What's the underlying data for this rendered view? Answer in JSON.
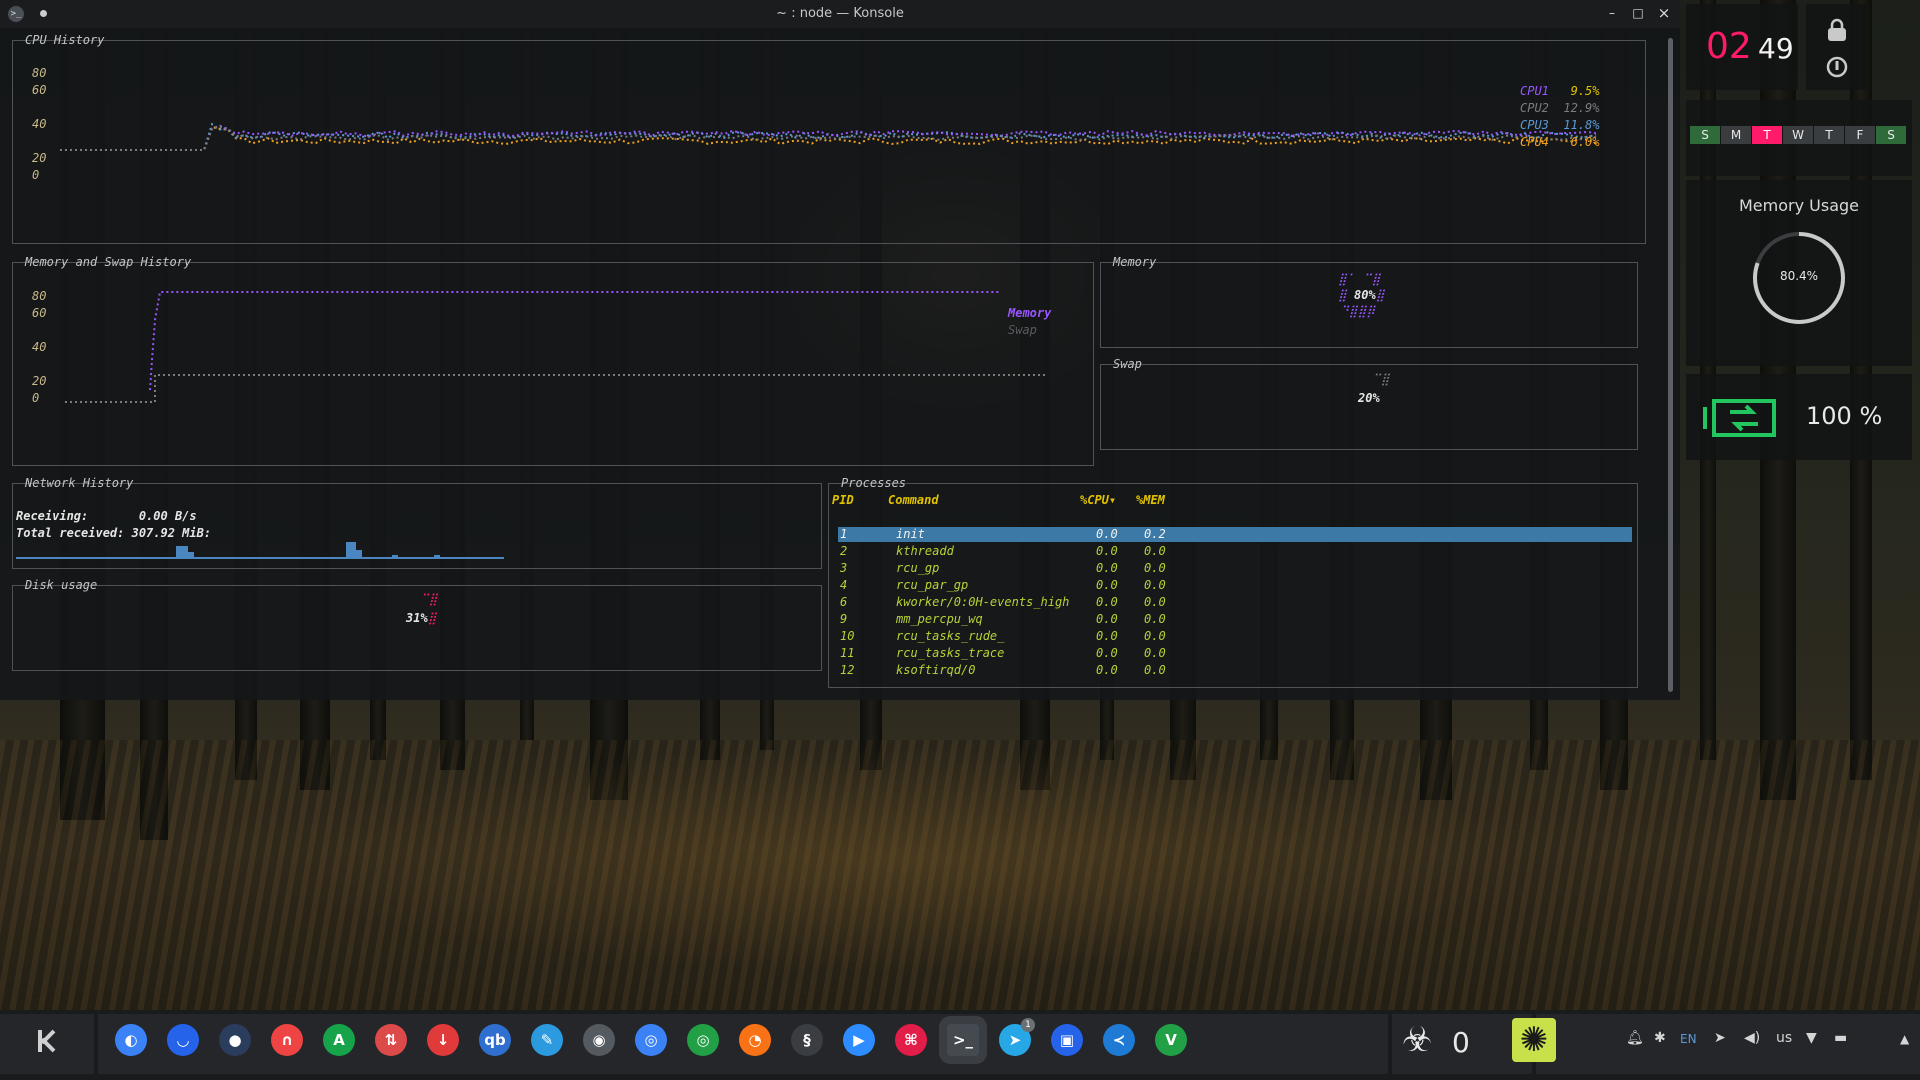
{
  "window": {
    "title": "~ : node — Konsole",
    "icon": "terminal-icon",
    "minimize": "–",
    "maximize": "□",
    "close": "×"
  },
  "cpu": {
    "title": "CPU History",
    "yticks": [
      "80",
      "60",
      "40",
      "20",
      "0"
    ],
    "legend": [
      {
        "name": "CPU1",
        "value": "9.5%",
        "color": "#9a55ff"
      },
      {
        "name": "CPU2",
        "value": "12.9%",
        "color": "#7a7d80"
      },
      {
        "name": "CPU3",
        "value": "11.8%",
        "color": "#5b9ad5"
      },
      {
        "name": "CPU4",
        "value": "6.0%",
        "color": "#f0a020"
      }
    ]
  },
  "memswap": {
    "title": "Memory and Swap History",
    "yticks": [
      "80",
      "60",
      "40",
      "20",
      "0"
    ],
    "legend_memory": "Memory",
    "legend_swap": "Swap",
    "memory_color": "#9a55ff",
    "swap_color": "#7a7d80"
  },
  "memory": {
    "title": "Memory",
    "value": "80%"
  },
  "swap": {
    "title": "Swap",
    "value": "20%"
  },
  "network": {
    "title": "Network History",
    "receiving_label": "Receiving:",
    "receiving_value": "0.00 B/s",
    "total_label": "Total received:",
    "total_value": "307.92 MiB:"
  },
  "disk": {
    "title": "Disk usage",
    "value": "31%"
  },
  "processes": {
    "title": "Processes",
    "headers": {
      "pid": "PID",
      "command": "Command",
      "cpu": "%CPU▾",
      "mem": "%MEM"
    },
    "rows": [
      {
        "pid": "1",
        "command": "init",
        "cpu": "0.0",
        "mem": "0.2"
      },
      {
        "pid": "2",
        "command": "kthreadd",
        "cpu": "0.0",
        "mem": "0.0"
      },
      {
        "pid": "3",
        "command": "rcu_gp",
        "cpu": "0.0",
        "mem": "0.0"
      },
      {
        "pid": "4",
        "command": "rcu_par_gp",
        "cpu": "0.0",
        "mem": "0.0"
      },
      {
        "pid": "6",
        "command": "kworker/0:0H-events_high",
        "cpu": "0.0",
        "mem": "0.0"
      },
      {
        "pid": "9",
        "command": "mm_percpu_wq",
        "cpu": "0.0",
        "mem": "0.0"
      },
      {
        "pid": "10",
        "command": "rcu_tasks_rude_",
        "cpu": "0.0",
        "mem": "0.0"
      },
      {
        "pid": "11",
        "command": "rcu_tasks_trace",
        "cpu": "0.0",
        "mem": "0.0"
      },
      {
        "pid": "12",
        "command": "ksoftirqd/0",
        "cpu": "0.0",
        "mem": "0.0"
      }
    ]
  },
  "clock": {
    "hours": "02",
    "minutes": "49",
    "hours_color": "#ff1a6a"
  },
  "week": {
    "days": [
      "S",
      "M",
      "T",
      "W",
      "T",
      "F",
      "S"
    ],
    "today_index": 2
  },
  "memory_widget": {
    "title": "Memory Usage",
    "value": "80.4%",
    "fraction": 0.804
  },
  "battery_widget": {
    "value": "100 %",
    "icon": "battery-charging-icon",
    "color": "#22c55e"
  },
  "taskbar": {
    "launcher_icon": "kde-launcher-icon",
    "apps": [
      {
        "name": "finder-app-icon",
        "glyph": "◐",
        "color": "#3b82f6"
      },
      {
        "name": "chat-app-icon",
        "glyph": "◡",
        "color": "#2563eb"
      },
      {
        "name": "orb-app-icon",
        "glyph": "●",
        "color": "#2b3d5c"
      },
      {
        "name": "headphones-app-icon",
        "glyph": "∩",
        "color": "#ef4444"
      },
      {
        "name": "a-app-icon",
        "glyph": "A",
        "color": "#16a34a"
      },
      {
        "name": "tools-app-icon",
        "glyph": "⇅",
        "color": "#dc4a4a"
      },
      {
        "name": "download-app-icon",
        "glyph": "↓",
        "color": "#e03a3a"
      },
      {
        "name": "qbittorrent-app-icon",
        "glyph": "qb",
        "color": "#2f6fd0"
      },
      {
        "name": "pen-app-icon",
        "glyph": "✎",
        "color": "#2b9adf"
      },
      {
        "name": "github-app-icon",
        "glyph": "◉",
        "color": "#555a60"
      },
      {
        "name": "chromium-app-icon",
        "glyph": "◎",
        "color": "#3b82f6"
      },
      {
        "name": "chrome-app-icon",
        "glyph": "◎",
        "color": "#22a046"
      },
      {
        "name": "firefox-app-icon",
        "glyph": "◔",
        "color": "#f97316"
      },
      {
        "name": "steam-app-icon",
        "glyph": "§",
        "color": "#3a3d42"
      },
      {
        "name": "zoom-app-icon",
        "glyph": "▶",
        "color": "#2d8cff"
      },
      {
        "name": "pdf-app-icon",
        "glyph": "⌘",
        "color": "#e11d48"
      },
      {
        "name": "konsole-app-icon",
        "glyph": ">_",
        "color": "#444a50"
      },
      {
        "name": "telegram-app-icon",
        "glyph": "➤",
        "color": "#27a7e5"
      },
      {
        "name": "virtualbox-app-icon",
        "glyph": "▣",
        "color": "#2563eb"
      },
      {
        "name": "vscode-app-icon",
        "glyph": "≺",
        "color": "#1f7ad6"
      },
      {
        "name": "vim-app-icon",
        "glyph": "V",
        "color": "#22a046"
      }
    ],
    "telegram_badge": "1",
    "biohazard_count": "0",
    "tray": {
      "lang": "EN",
      "layout": "us"
    }
  }
}
